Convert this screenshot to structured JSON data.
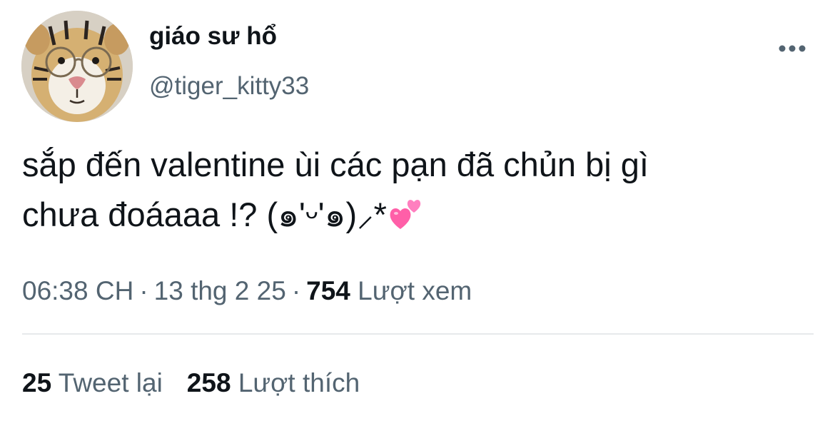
{
  "author": {
    "display_name": "giáo sư hổ",
    "handle": "@tiger_kitty33",
    "avatar_icon": "tiger-with-glasses-avatar"
  },
  "tweet": {
    "line1": "sắp đến valentine ùi các pạn đã chủn bị gì",
    "line2": "chưa đoáaaa !? (๑'ᵕ'๑)⸝*",
    "emoji": "two-hearts-emoji"
  },
  "meta": {
    "time": "06:38 CH",
    "separator": "·",
    "date": "13 thg 2 25",
    "views_count": "754",
    "views_label": "Lượt xem"
  },
  "stats": {
    "retweets_count": "25",
    "retweets_label": "Tweet lại",
    "likes_count": "258",
    "likes_label": "Lượt thích"
  },
  "colors": {
    "text_primary": "#0f1419",
    "text_secondary": "#536471",
    "divider": "#e6e9eb",
    "heart": "#ff5fa8"
  }
}
